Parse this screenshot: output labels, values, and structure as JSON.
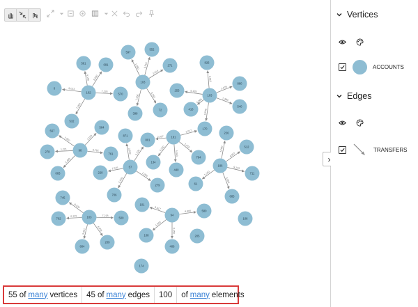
{
  "toolbar": {
    "items": [
      {
        "name": "pan-tool-icon",
        "active": true
      },
      {
        "name": "collapse-arrows-icon",
        "active": true
      },
      {
        "name": "select-hand-icon",
        "active": true
      },
      {
        "name": "expand-arrows-icon",
        "active": false
      },
      {
        "name": "dropdown-caret-icon",
        "active": false
      },
      {
        "name": "fit-view-icon",
        "active": false
      },
      {
        "name": "target-icon",
        "active": false
      },
      {
        "name": "layout-icon",
        "active": false
      },
      {
        "name": "dropdown-caret-icon",
        "active": false
      },
      {
        "name": "grid-icon",
        "active": false
      },
      {
        "name": "undo-icon",
        "active": false
      },
      {
        "name": "redo-icon",
        "active": false
      },
      {
        "name": "pin-icon",
        "active": false
      }
    ]
  },
  "graph": {
    "node_color": "#8ebdd3",
    "edge_color": "#8c8c8c",
    "nodes": [
      {
        "id": "n1",
        "label": "581"
      },
      {
        "id": "n2",
        "label": "681"
      },
      {
        "id": "n3",
        "label": "0"
      },
      {
        "id": "n4",
        "label": "102"
      },
      {
        "id": "n5",
        "label": "570"
      },
      {
        "id": "n6",
        "label": "532"
      },
      {
        "id": "n7",
        "label": "597"
      },
      {
        "id": "n8",
        "label": "552"
      },
      {
        "id": "n9",
        "label": "271"
      },
      {
        "id": "n10",
        "label": "103"
      },
      {
        "id": "n11",
        "label": "398"
      },
      {
        "id": "n12",
        "label": "72"
      },
      {
        "id": "n13",
        "label": "253"
      },
      {
        "id": "n14",
        "label": "826"
      },
      {
        "id": "n15",
        "label": "880"
      },
      {
        "id": "n16",
        "label": "103"
      },
      {
        "id": "n17",
        "label": "540"
      },
      {
        "id": "n18",
        "label": "418"
      },
      {
        "id": "n19",
        "label": "170"
      },
      {
        "id": "n20",
        "label": "567"
      },
      {
        "id": "n21",
        "label": "564"
      },
      {
        "id": "n22",
        "label": "278"
      },
      {
        "id": "n23",
        "label": "98"
      },
      {
        "id": "n24",
        "label": "761"
      },
      {
        "id": "n25",
        "label": "083"
      },
      {
        "id": "n26",
        "label": "871"
      },
      {
        "id": "n27",
        "label": "801"
      },
      {
        "id": "n28",
        "label": "181"
      },
      {
        "id": "n29",
        "label": "226"
      },
      {
        "id": "n30",
        "label": "512"
      },
      {
        "id": "n31",
        "label": "186"
      },
      {
        "id": "n32",
        "label": "794"
      },
      {
        "id": "n33",
        "label": "220"
      },
      {
        "id": "n34",
        "label": "57"
      },
      {
        "id": "n35",
        "label": "134"
      },
      {
        "id": "n36",
        "label": "440"
      },
      {
        "id": "n37",
        "label": "711"
      },
      {
        "id": "n38",
        "label": "706"
      },
      {
        "id": "n39",
        "label": "279"
      },
      {
        "id": "n40",
        "label": "61"
      },
      {
        "id": "n41",
        "label": "685"
      },
      {
        "id": "n42",
        "label": "745"
      },
      {
        "id": "n43",
        "label": "702"
      },
      {
        "id": "n44",
        "label": "103"
      },
      {
        "id": "n45",
        "label": "500"
      },
      {
        "id": "n46",
        "label": "804"
      },
      {
        "id": "n47",
        "label": "209"
      },
      {
        "id": "n48",
        "label": "101"
      },
      {
        "id": "n49",
        "label": "94"
      },
      {
        "id": "n50",
        "label": "580"
      },
      {
        "id": "n51",
        "label": "108"
      },
      {
        "id": "n52",
        "label": "406"
      },
      {
        "id": "n53",
        "label": "205"
      },
      {
        "id": "n54",
        "label": "106"
      },
      {
        "id": "n55",
        "label": "174"
      }
    ],
    "edges": [
      {
        "from": "n4",
        "to": "n1",
        "label": "6,190"
      },
      {
        "from": "n4",
        "to": "n2",
        "label": "8,050"
      },
      {
        "from": "n4",
        "to": "n3",
        "label": "9,013"
      },
      {
        "from": "n4",
        "to": "n5",
        "label": "7,226"
      },
      {
        "from": "n4",
        "to": "n6",
        "label": "7,900"
      },
      {
        "from": "n10",
        "to": "n7",
        "label": "1,080"
      },
      {
        "from": "n10",
        "to": "n8",
        "label": "9,015"
      },
      {
        "from": "n10",
        "to": "n9",
        "label": "2,013"
      },
      {
        "from": "n10",
        "to": "n11",
        "label": "7,056"
      },
      {
        "from": "n10",
        "to": "n12",
        "label": "8,250"
      },
      {
        "from": "n16",
        "to": "n14",
        "label": "2,055"
      },
      {
        "from": "n16",
        "to": "n15",
        "label": "3,025"
      },
      {
        "from": "n16",
        "to": "n13",
        "label": "5,135"
      },
      {
        "from": "n16",
        "to": "n17",
        "label": "1,380"
      },
      {
        "from": "n16",
        "to": "n18",
        "label": "4,065"
      },
      {
        "from": "n16",
        "to": "n19",
        "label": "9,046"
      },
      {
        "from": "n23",
        "to": "n20",
        "label": "7,962"
      },
      {
        "from": "n23",
        "to": "n21",
        "label": "3,100"
      },
      {
        "from": "n23",
        "to": "n22",
        "label": "1,221"
      },
      {
        "from": "n23",
        "to": "n24",
        "label": "8,792"
      },
      {
        "from": "n23",
        "to": "n25",
        "label": "2,450"
      },
      {
        "from": "n28",
        "to": "n19",
        "label": "1,017"
      },
      {
        "from": "n28",
        "to": "n27",
        "label": "2,057"
      },
      {
        "from": "n28",
        "to": "n32",
        "label": "1,910"
      },
      {
        "from": "n28",
        "to": "n35",
        "label": "4,250"
      },
      {
        "from": "n28",
        "to": "n36",
        "label": "5,043"
      },
      {
        "from": "n31",
        "to": "n29",
        "label": "5,080"
      },
      {
        "from": "n31",
        "to": "n30",
        "label": "4,007"
      },
      {
        "from": "n31",
        "to": "n37",
        "label": "9,143"
      },
      {
        "from": "n31",
        "to": "n40",
        "label": "1,390"
      },
      {
        "from": "n31",
        "to": "n41",
        "label": "6,050"
      },
      {
        "from": "n34",
        "to": "n26",
        "label": "3,209"
      },
      {
        "from": "n34",
        "to": "n27",
        "label": "4,125"
      },
      {
        "from": "n34",
        "to": "n33",
        "label": "1,516"
      },
      {
        "from": "n34",
        "to": "n38",
        "label": "5,009"
      },
      {
        "from": "n34",
        "to": "n39",
        "label": "2,300"
      },
      {
        "from": "n44",
        "to": "n42",
        "label": "8,530"
      },
      {
        "from": "n44",
        "to": "n43",
        "label": "6,129"
      },
      {
        "from": "n44",
        "to": "n45",
        "label": "7,218"
      },
      {
        "from": "n44",
        "to": "n46",
        "label": "9,061"
      },
      {
        "from": "n44",
        "to": "n47",
        "label": "4,055"
      },
      {
        "from": "n49",
        "to": "n48",
        "label": "3,017"
      },
      {
        "from": "n49",
        "to": "n50",
        "label": "8,800"
      },
      {
        "from": "n49",
        "to": "n51",
        "label": "1,940"
      },
      {
        "from": "n49",
        "to": "n52",
        "label": "6,450"
      }
    ]
  },
  "panel": {
    "collapse_icon": "chevron-right-icon",
    "vertices": {
      "title": "Vertices",
      "icons": [
        "eye-icon",
        "palette-icon"
      ],
      "items": [
        {
          "label": "ACCOUNTS",
          "checked": true,
          "color": "#8ebdd3"
        }
      ]
    },
    "edges": {
      "title": "Edges",
      "icons": [
        "eye-icon",
        "palette-icon"
      ],
      "items": [
        {
          "label": "TRANSFERS",
          "checked": true,
          "color": "#8c8c8c"
        }
      ]
    }
  },
  "status": {
    "vertices_count": "55",
    "edges_count": "45",
    "elements_count": "100",
    "of": "of",
    "many": "many",
    "vertices_word": "vertices",
    "edges_word": "edges",
    "elements_word": "elements"
  }
}
